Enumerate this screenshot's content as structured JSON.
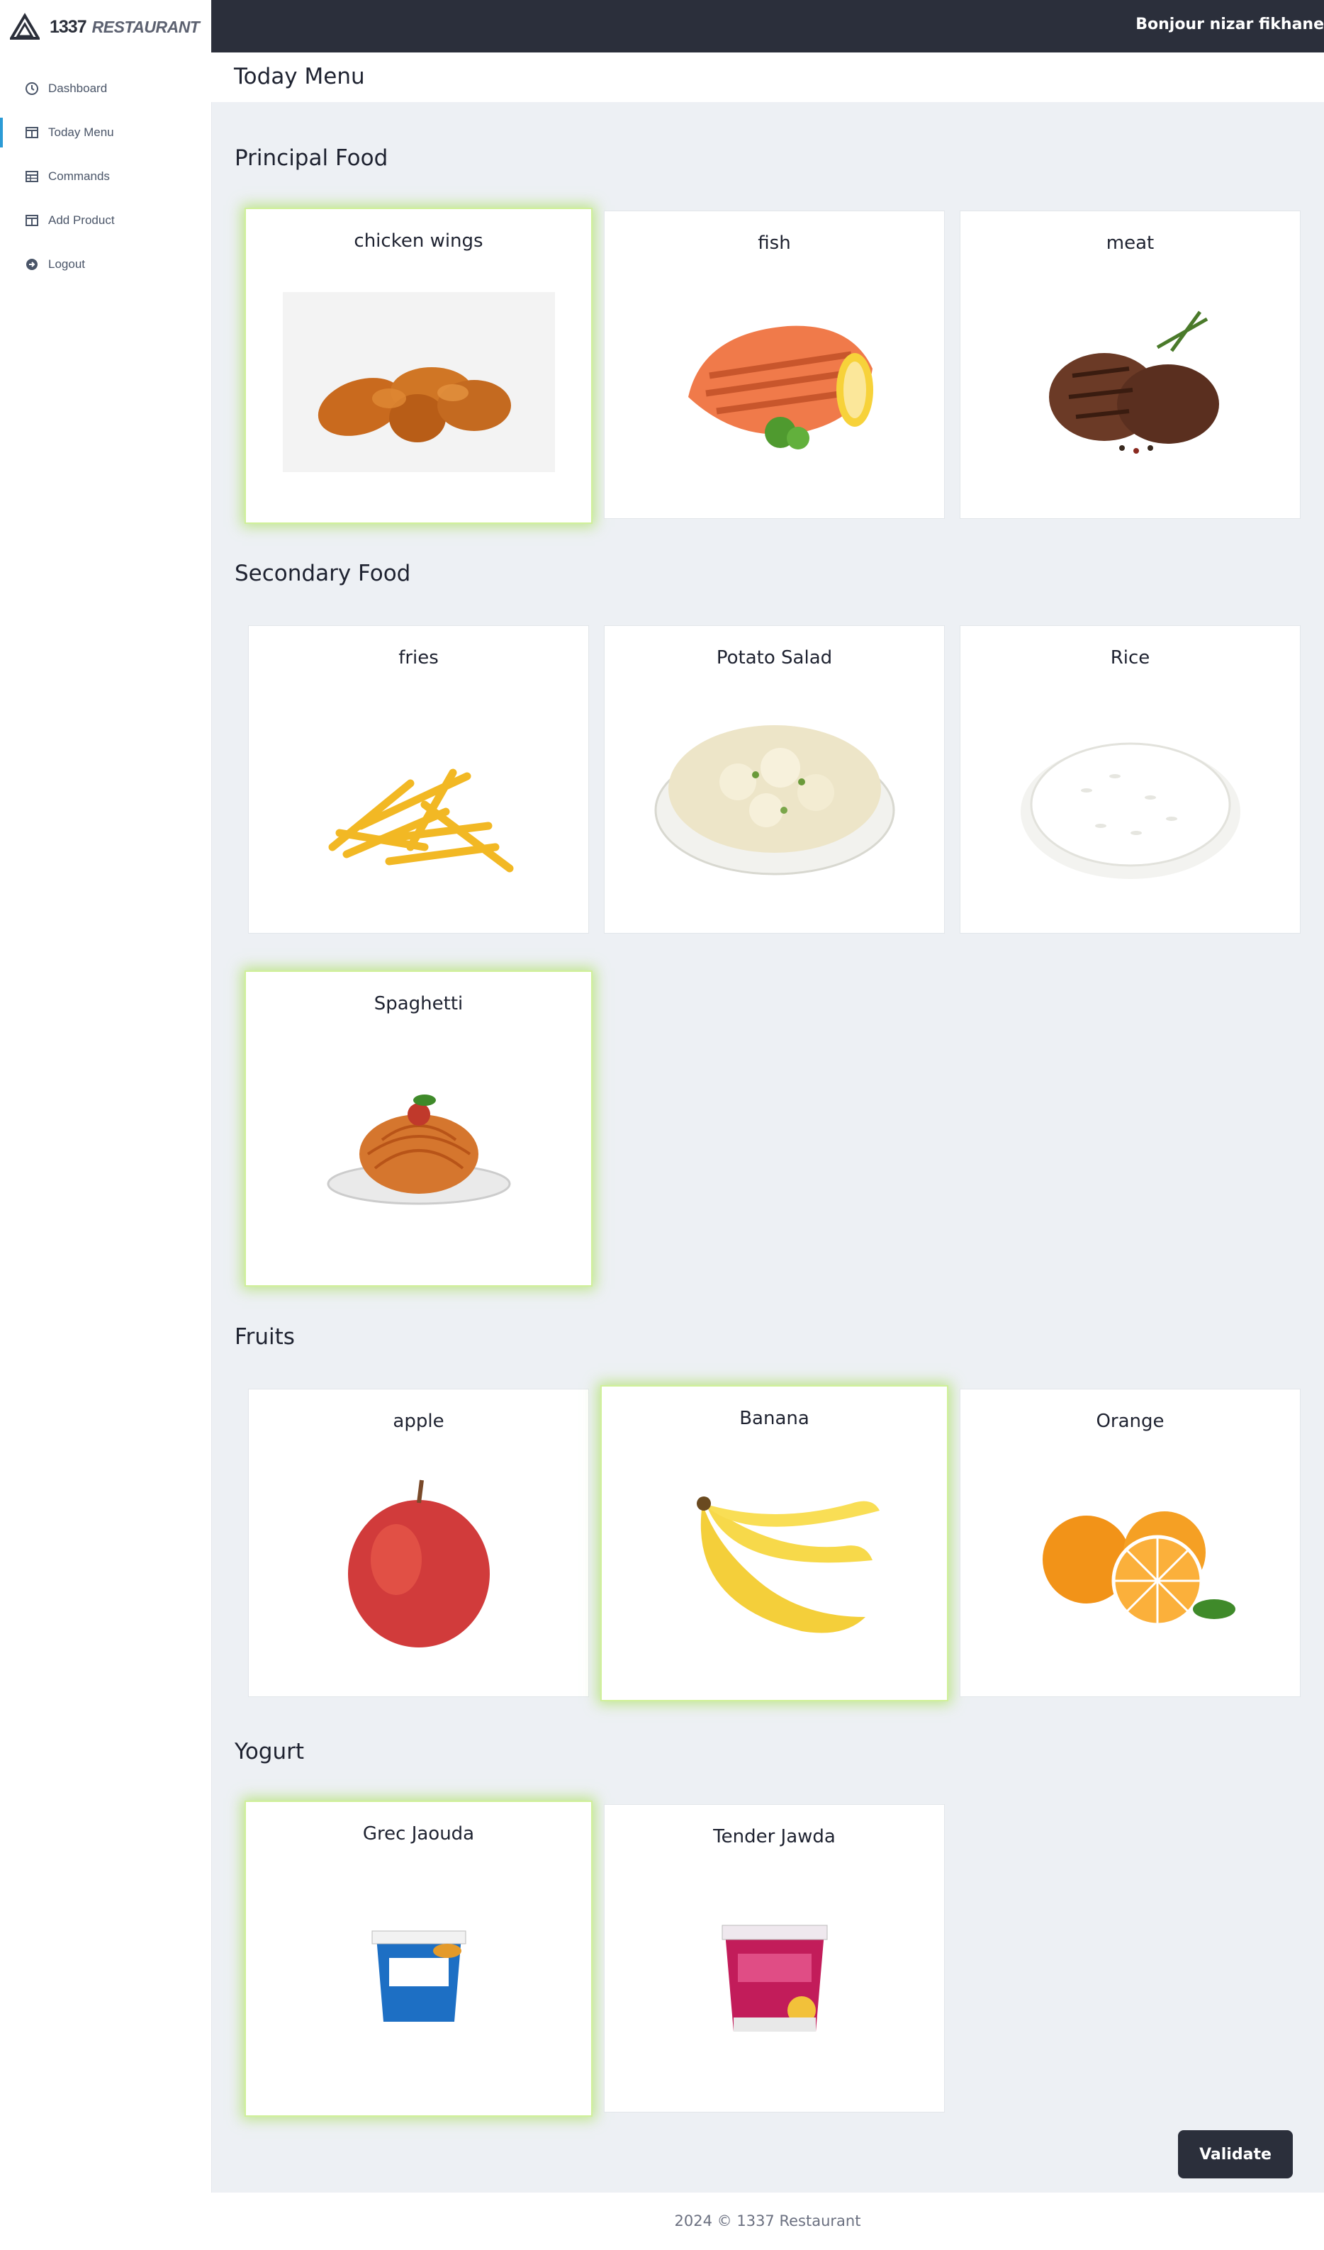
{
  "brand": {
    "number": "1337",
    "name": "RESTAURANT"
  },
  "sidebar": {
    "items": [
      {
        "label": "Dashboard",
        "icon": "clock-icon"
      },
      {
        "label": "Today Menu",
        "icon": "columns-icon",
        "active": true
      },
      {
        "label": "Commands",
        "icon": "table-icon"
      },
      {
        "label": "Add Product",
        "icon": "columns-icon"
      },
      {
        "label": "Logout",
        "icon": "arrow-circle-icon"
      }
    ]
  },
  "topbar": {
    "greeting": "Bonjour nizar fikhane"
  },
  "page": {
    "title": "Today Menu"
  },
  "colors": {
    "accent": "#2b9bd6",
    "dark": "#2b2f3b",
    "selected_glow": "#a5de52"
  },
  "sections": [
    {
      "title": "Principal Food",
      "items": [
        {
          "name": "chicken wings",
          "selected": true
        },
        {
          "name": "fish",
          "selected": false
        },
        {
          "name": "meat",
          "selected": false
        }
      ]
    },
    {
      "title": "Secondary Food",
      "items": [
        {
          "name": "fries",
          "selected": false
        },
        {
          "name": "Potato Salad",
          "selected": false
        },
        {
          "name": "Rice",
          "selected": false
        },
        {
          "name": "Spaghetti",
          "selected": true
        }
      ]
    },
    {
      "title": "Fruits",
      "items": [
        {
          "name": "apple",
          "selected": false
        },
        {
          "name": "Banana",
          "selected": true
        },
        {
          "name": "Orange",
          "selected": false
        }
      ]
    },
    {
      "title": "Yogurt",
      "items": [
        {
          "name": "Grec Jaouda",
          "selected": true
        },
        {
          "name": "Tender Jawda",
          "selected": false
        }
      ]
    }
  ],
  "actions": {
    "validate_label": "Validate"
  },
  "footer": {
    "text": "2024 © 1337 Restaurant"
  }
}
